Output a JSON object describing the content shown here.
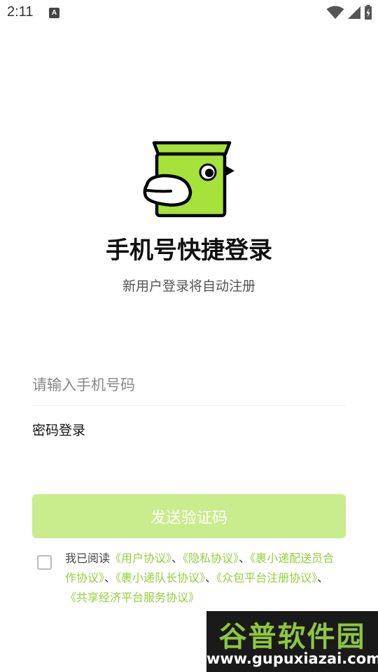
{
  "status_bar": {
    "time": "2:11",
    "notification_icon_letter": "A",
    "icons": [
      "wifi-icon",
      "cell-signal-icon",
      "battery-icon"
    ]
  },
  "header": {
    "title": "手机号快捷登录",
    "subtitle": "新用户登录将自动注册"
  },
  "form": {
    "phone_placeholder": "请输入手机号码",
    "phone_value": "",
    "password_login_label": "密码登录",
    "send_code_button_label": "发送验证码",
    "send_code_enabled": false
  },
  "agreement": {
    "checked": false,
    "prefix": "我已阅读",
    "separator": "、",
    "links": [
      "《用户协议》",
      "《隐私协议》",
      "《裹小递配送员合作协议》",
      "《裹小递队长协议》",
      "《众包平台注册协议》",
      "《共享经济平台服务协议》"
    ]
  },
  "watermark": {
    "top": "谷普软件园",
    "bottom": "www.gupuxiazai.com"
  },
  "colors": {
    "brand_green": "#a6e23a",
    "link_green": "#94d03a",
    "button_disabled": "#c9ec8c"
  }
}
